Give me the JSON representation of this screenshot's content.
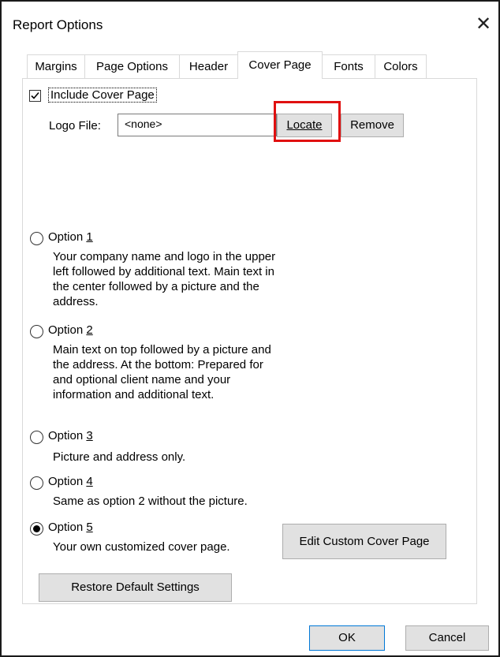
{
  "window": {
    "title": "Report Options",
    "close_glyph": "✕"
  },
  "tabs": [
    {
      "label": "Margins"
    },
    {
      "label": "Page Options"
    },
    {
      "label": "Header"
    },
    {
      "label": "Cover Page",
      "active": true
    },
    {
      "label": "Fonts"
    },
    {
      "label": "Colors"
    }
  ],
  "cover": {
    "include_label": "Include Cover Page",
    "include_checked": true,
    "logo_label": "Logo File:",
    "logo_value": "<none>",
    "locate_label": "Locate",
    "remove_label": "Remove"
  },
  "options": [
    {
      "prefix": "Option ",
      "key": "1",
      "selected": false,
      "desc": "Your company name and logo in the upper left followed by additional text. Main text in the center followed by a picture and the address."
    },
    {
      "prefix": "Option ",
      "key": "2",
      "selected": false,
      "desc": "Main text on top followed by a picture and the address. At the bottom: Prepared for and optional client name and your information and additional text."
    },
    {
      "prefix": "Option ",
      "key": "3",
      "selected": false,
      "desc": "Picture and address only."
    },
    {
      "prefix": "Option ",
      "key": "4",
      "selected": false,
      "desc": "Same as option 2 without the picture."
    },
    {
      "prefix": "Option ",
      "key": "5",
      "selected": true,
      "desc": "Your own customized cover page."
    }
  ],
  "buttons": {
    "edit_custom": "Edit Custom Cover Page",
    "restore": "Restore Default Settings",
    "ok": "OK",
    "cancel": "Cancel"
  },
  "colors": {
    "highlight": "#e01010",
    "default_button_border": "#0078d7"
  }
}
